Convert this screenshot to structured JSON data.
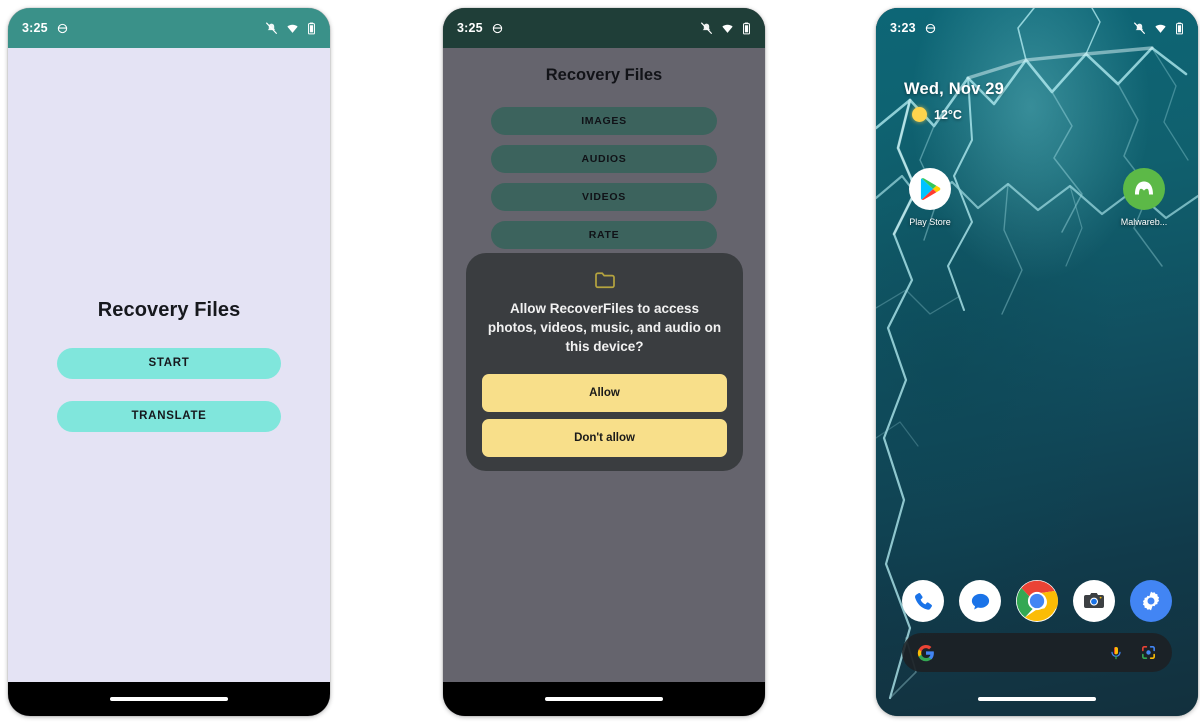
{
  "phones": [
    {
      "id": "app-landing",
      "statusbar": {
        "time": "3:25",
        "icons": [
          "notifications-off-icon",
          "wifi-icon",
          "battery-icon"
        ]
      },
      "app": {
        "title": "Recovery Files",
        "buttons": [
          {
            "label": "START",
            "name": "start-button"
          },
          {
            "label": "TRANSLATE",
            "name": "translate-button"
          }
        ]
      },
      "colors": {
        "status_bar": "#3a9189",
        "background": "#e4e3f4",
        "button": "#80e6dc"
      }
    },
    {
      "id": "permission-dialog",
      "statusbar": {
        "time": "3:25",
        "icons": [
          "notifications-off-icon",
          "wifi-icon",
          "battery-icon"
        ]
      },
      "app": {
        "title": "Recovery Files",
        "buttons": [
          {
            "label": "IMAGES",
            "name": "images-button"
          },
          {
            "label": "AUDIOS",
            "name": "audios-button"
          },
          {
            "label": "VIDEOS",
            "name": "videos-button"
          },
          {
            "label": "RATE",
            "name": "rate-button"
          }
        ]
      },
      "dialog": {
        "icon": "folder-icon",
        "message": "Allow RecoverFiles to access photos, videos, music, and audio on this device?",
        "allow_label": "Allow",
        "deny_label": "Don't allow"
      },
      "colors": {
        "status_bar": "#1f3e38",
        "background": "#65646d",
        "button": "#3c635d",
        "dialog_bg": "#3a3d40",
        "dialog_button": "#f8df8a"
      }
    },
    {
      "id": "android-home",
      "statusbar": {
        "time": "3:23",
        "icons": [
          "notifications-off-icon",
          "wifi-icon",
          "battery-icon"
        ]
      },
      "widget": {
        "date": "Wed, Nov 29",
        "temperature": "12°C",
        "weather_icon": "sun-icon"
      },
      "apps": [
        {
          "label": "Play Store",
          "name": "play-store-icon"
        },
        {
          "label": "Malwareb...",
          "name": "malwarebytes-icon"
        }
      ],
      "dock": [
        {
          "name": "phone-icon"
        },
        {
          "name": "messages-icon"
        },
        {
          "name": "chrome-icon"
        },
        {
          "name": "camera-icon"
        },
        {
          "name": "settings-icon"
        }
      ],
      "search": {
        "logo": "google-g-icon",
        "mic": "microphone-icon",
        "lens": "google-lens-icon"
      }
    }
  ]
}
